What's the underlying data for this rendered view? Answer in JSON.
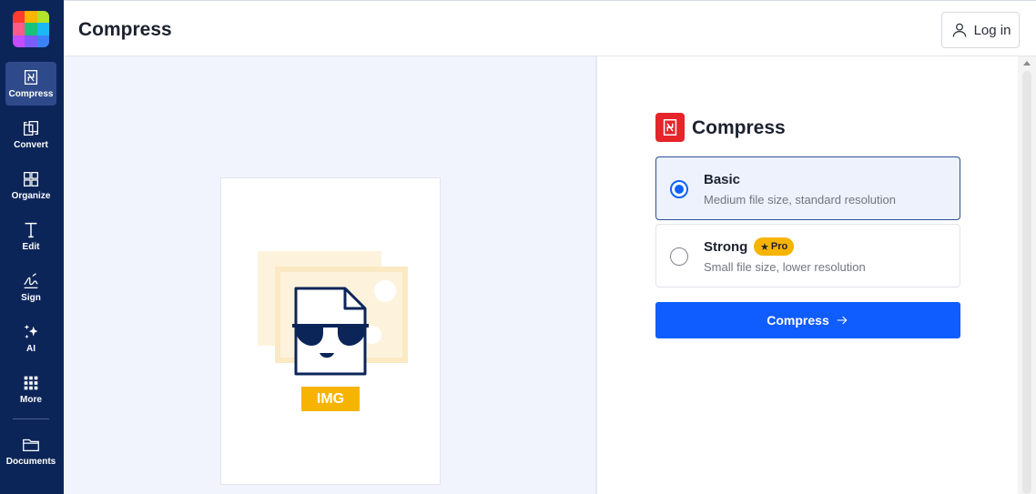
{
  "app": {
    "title": "Compress",
    "login_label": "Log in"
  },
  "colors": {
    "sidebar_bg": "#0c2559",
    "accent_blue": "#0f5cff",
    "pro_yellow": "#f6b400",
    "compress_red": "#e5252a"
  },
  "sidebar": {
    "items": [
      {
        "label": "Compress",
        "icon": "compress-icon",
        "active": true
      },
      {
        "label": "Convert",
        "icon": "convert-icon",
        "active": false
      },
      {
        "label": "Organize",
        "icon": "organize-icon",
        "active": false
      },
      {
        "label": "Edit",
        "icon": "edit-text-icon",
        "active": false
      },
      {
        "label": "Sign",
        "icon": "signature-icon",
        "active": false
      },
      {
        "label": "AI",
        "icon": "sparkle-icon",
        "active": false
      },
      {
        "label": "More",
        "icon": "grid-dots-icon",
        "active": false
      },
      {
        "label": "Documents",
        "icon": "folder-icon",
        "active": false
      }
    ]
  },
  "preview": {
    "file_type_label": "IMG",
    "icon": "file-sunglasses-icon"
  },
  "options": {
    "heading": "Compress",
    "levels": [
      {
        "name": "Basic",
        "description": "Medium file size, standard resolution",
        "selected": true
      },
      {
        "name": "Strong",
        "description": "Small file size, lower resolution",
        "selected": false,
        "badge": "Pro"
      }
    ],
    "submit_label": "Compress"
  }
}
